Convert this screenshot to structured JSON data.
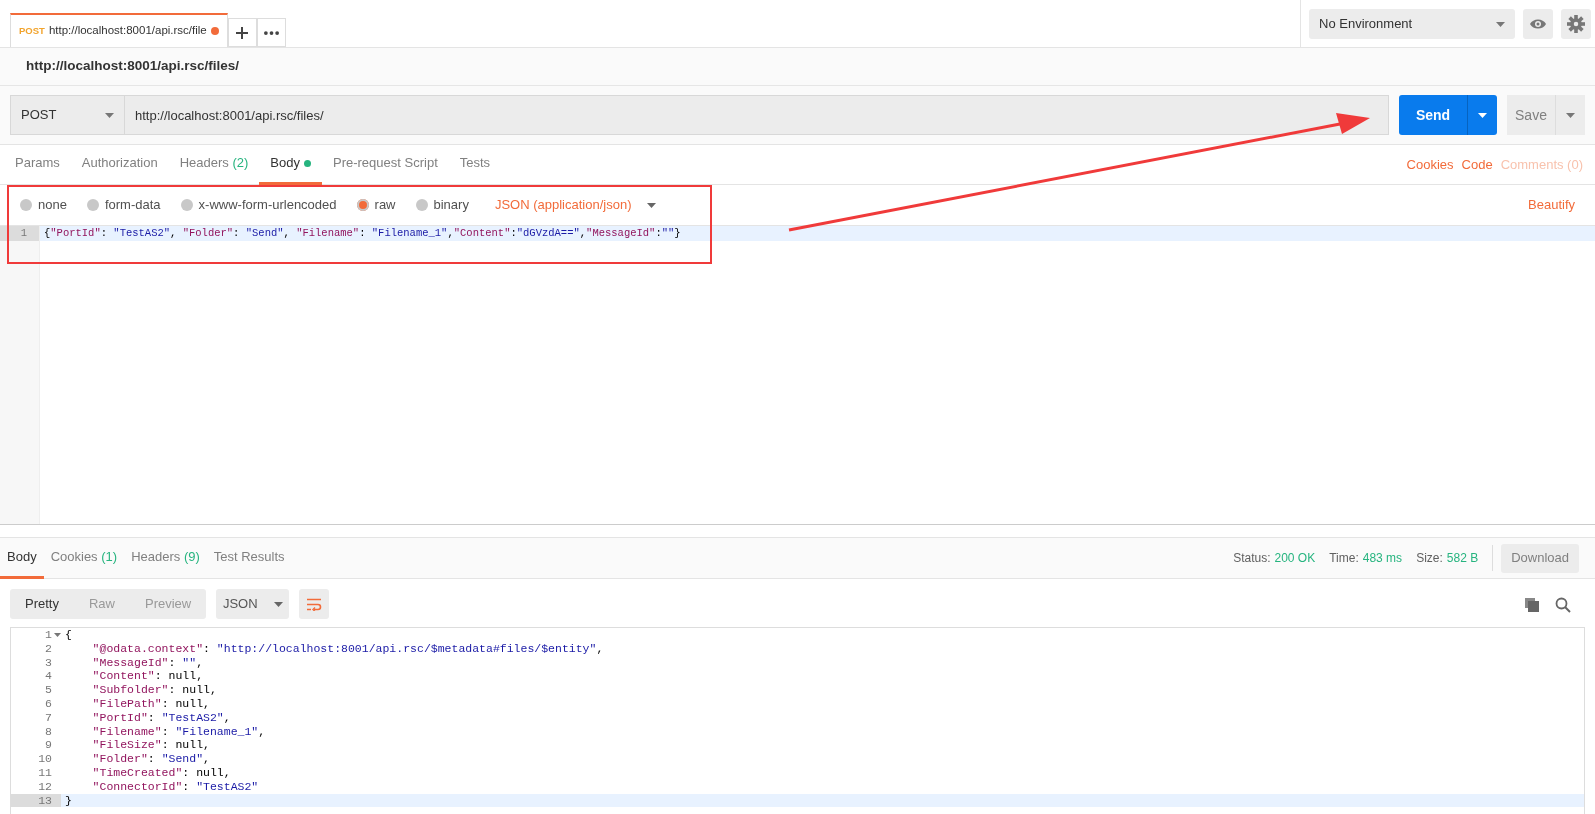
{
  "request_tabs": [
    {
      "method": "POST",
      "url": "http://localhost:8001/api.rsc/file",
      "unsaved": true,
      "selected": true
    }
  ],
  "environment": {
    "value": "No Environment"
  },
  "request_title": "http://localhost:8001/api.rsc/files/",
  "request": {
    "method": "POST",
    "url": "http://localhost:8001/api.rsc/files/",
    "send": "Send",
    "save": "Save"
  },
  "tabs": [
    {
      "label": "Params",
      "selected": false
    },
    {
      "label": "Authorization",
      "selected": false
    },
    {
      "label": "Headers",
      "count": "(2)",
      "selected": false
    },
    {
      "label": "Body",
      "selected": true,
      "has_content": true
    },
    {
      "label": "Pre-request Script",
      "selected": false
    },
    {
      "label": "Tests",
      "selected": false
    }
  ],
  "links": [
    {
      "label": "Cookies",
      "disabled": false
    },
    {
      "label": "Code",
      "disabled": false
    },
    {
      "label": "Comments (0)",
      "disabled": true
    }
  ],
  "body_modes": [
    {
      "label": "none",
      "selected": false
    },
    {
      "label": "form-data",
      "selected": false
    },
    {
      "label": "x-www-form-urlencoded",
      "selected": false
    },
    {
      "label": "raw",
      "selected": true
    },
    {
      "label": "binary",
      "selected": false
    }
  ],
  "content_type": "JSON (application/json)",
  "beautify": "Beautify",
  "request_body": {
    "lines": [
      {
        "number": "1",
        "text": "{\"PortId\": \"TestAS2\", \"Folder\": \"Send\", \"Filename\": \"Filename_1\",\"Content\":\"dGVzdA==\",\"MessageId\":\"\"}",
        "current": true
      }
    ]
  },
  "response_tabs": [
    {
      "label": "Body",
      "selected": true
    },
    {
      "label": "Cookies",
      "count": "(1)",
      "selected": false
    },
    {
      "label": "Headers",
      "count": "(9)",
      "selected": false
    },
    {
      "label": "Test Results",
      "selected": false
    }
  ],
  "status": [
    {
      "label": "Status:",
      "value": "200 OK"
    },
    {
      "label": "Time:",
      "value": "483 ms"
    },
    {
      "label": "Size:",
      "value": "582 B"
    }
  ],
  "download": "Download",
  "view_modes": [
    {
      "label": "Pretty",
      "selected": true
    },
    {
      "label": "Raw",
      "selected": false
    },
    {
      "label": "Preview",
      "selected": false
    }
  ],
  "format": "JSON",
  "response_body": {
    "lines": [
      {
        "number": "1",
        "text": "{",
        "foldable": true,
        "current": false
      },
      {
        "number": "2",
        "text": "    \"@odata.context\": \"http://localhost:8001/api.rsc/$metadata#files/$entity\",",
        "foldable": false,
        "current": false
      },
      {
        "number": "3",
        "text": "    \"MessageId\": \"\",",
        "foldable": false,
        "current": false
      },
      {
        "number": "4",
        "text": "    \"Content\": null,",
        "foldable": false,
        "current": false
      },
      {
        "number": "5",
        "text": "    \"Subfolder\": null,",
        "foldable": false,
        "current": false
      },
      {
        "number": "6",
        "text": "    \"FilePath\": null,",
        "foldable": false,
        "current": false
      },
      {
        "number": "7",
        "text": "    \"PortId\": \"TestAS2\",",
        "foldable": false,
        "current": false
      },
      {
        "number": "8",
        "text": "    \"Filename\": \"Filename_1\",",
        "foldable": false,
        "current": false
      },
      {
        "number": "9",
        "text": "    \"FileSize\": null,",
        "foldable": false,
        "current": false
      },
      {
        "number": "10",
        "text": "    \"Folder\": \"Send\",",
        "foldable": false,
        "current": false
      },
      {
        "number": "11",
        "text": "    \"TimeCreated\": null,",
        "foldable": false,
        "current": false
      },
      {
        "number": "12",
        "text": "    \"ConnectorId\": \"TestAS2\"",
        "foldable": false,
        "current": false
      },
      {
        "number": "13",
        "text": "}",
        "foldable": false,
        "current": true
      }
    ]
  }
}
